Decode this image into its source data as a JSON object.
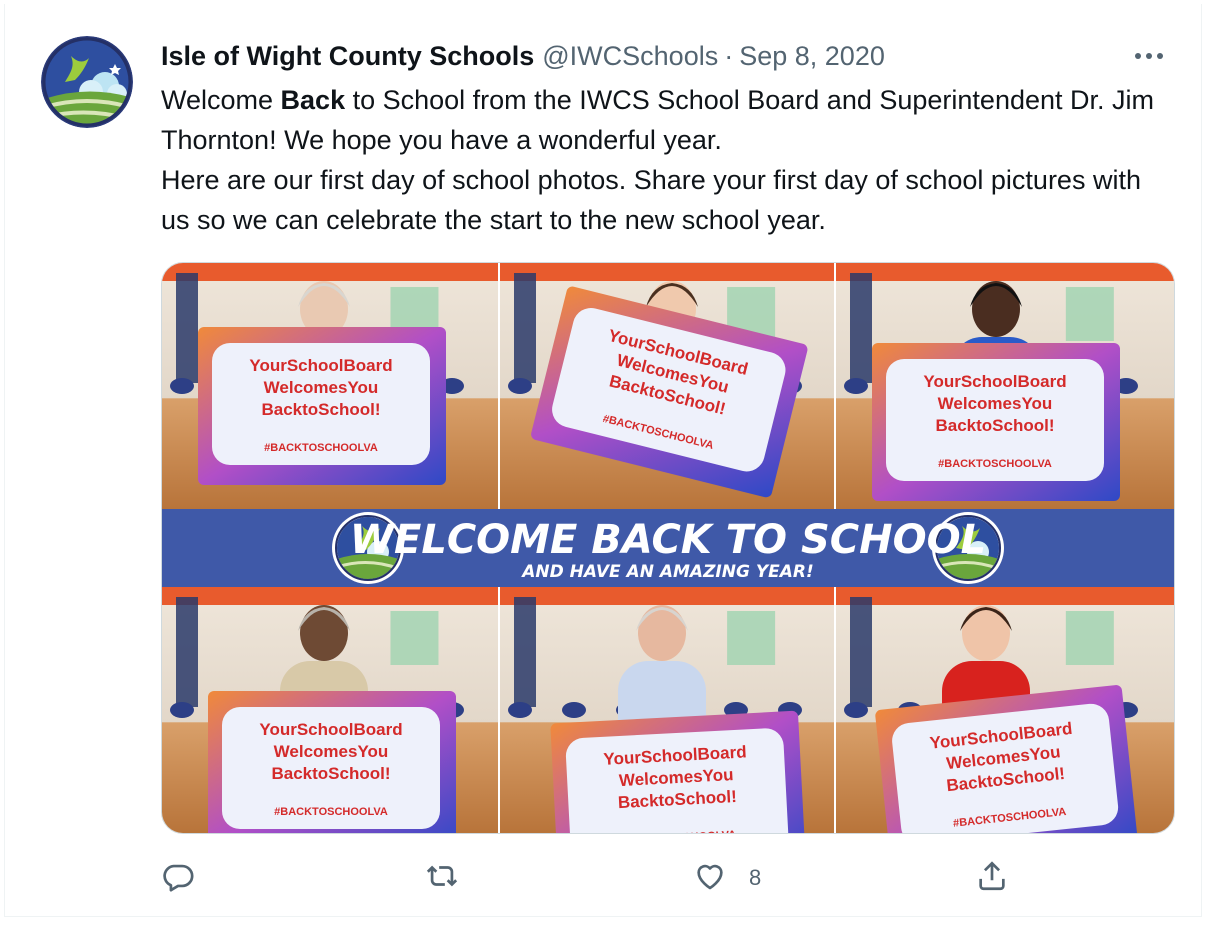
{
  "tweet": {
    "display_name": "Isle of Wight County Schools",
    "handle": "@IWCSchools",
    "separator": "·",
    "date": "Sep 8, 2020",
    "text": {
      "p1_a": "Welcome ",
      "p1_bold": "Back",
      "p1_b": " to School from the IWCS School Board and Superintendent Dr. Jim Thornton! We hope you have a wonderful year.",
      "p2": "Here are our first day of school photos.  Share your first day of school pictures with us so we can celebrate the start to the new school year."
    }
  },
  "media": {
    "banner_title": "WELCOME BACK TO SCHOOL",
    "banner_subtitle": "AND HAVE AN AMAZING YEAR!",
    "sign_line1": "YourSchoolBoard",
    "sign_line2": "WelcomesYou",
    "sign_line3": "BacktoSchool!",
    "sign_hashtag": "#BACKTOSCHOOLVA",
    "shirt_colors": [
      "#f1f1f1",
      "#1a1a1a",
      "#2a5bc9",
      "#d8c9a8",
      "#c9d7ee",
      "#d8221e"
    ],
    "skin_colors": [
      "#e9c9b2",
      "#f0c9ad",
      "#4a2d20",
      "#6e4a34",
      "#e6b89f",
      "#efc4a8"
    ],
    "hair_colors": [
      "#d9d6d0",
      "#4a3020",
      "#111111",
      "#b7b2aa",
      "#d8d4cf",
      "#3b2418"
    ],
    "colors": {
      "banner": "#3f59a8",
      "sign_text": "#d42a2a",
      "floor": "#b8743a",
      "wall": "#ded5c8",
      "ceiling_orange": "#e85b2d"
    }
  },
  "actions": {
    "reply_icon": "reply-icon",
    "retweet_icon": "retweet-icon",
    "like_icon": "like-icon",
    "like_count": "8",
    "share_icon": "share-icon"
  }
}
